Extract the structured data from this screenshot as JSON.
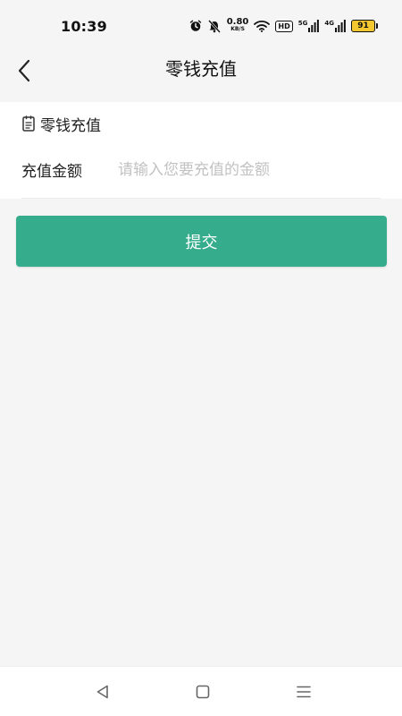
{
  "status_bar": {
    "time": "10:39",
    "net_speed_value": "0.80",
    "net_speed_unit": "KB/S",
    "hd_label": "HD",
    "signal_1_label": "5G",
    "signal_2_label": "4G",
    "battery_level": "91"
  },
  "header": {
    "title": "零钱充值"
  },
  "form": {
    "section_title": "零钱充值",
    "amount_label": "充值金额",
    "amount_placeholder": "请输入您要充值的金额",
    "amount_value": ""
  },
  "actions": {
    "submit_label": "提交"
  },
  "colors": {
    "accent": "#35ad8c",
    "background": "#f5f5f5",
    "battery": "#f3c72f"
  }
}
